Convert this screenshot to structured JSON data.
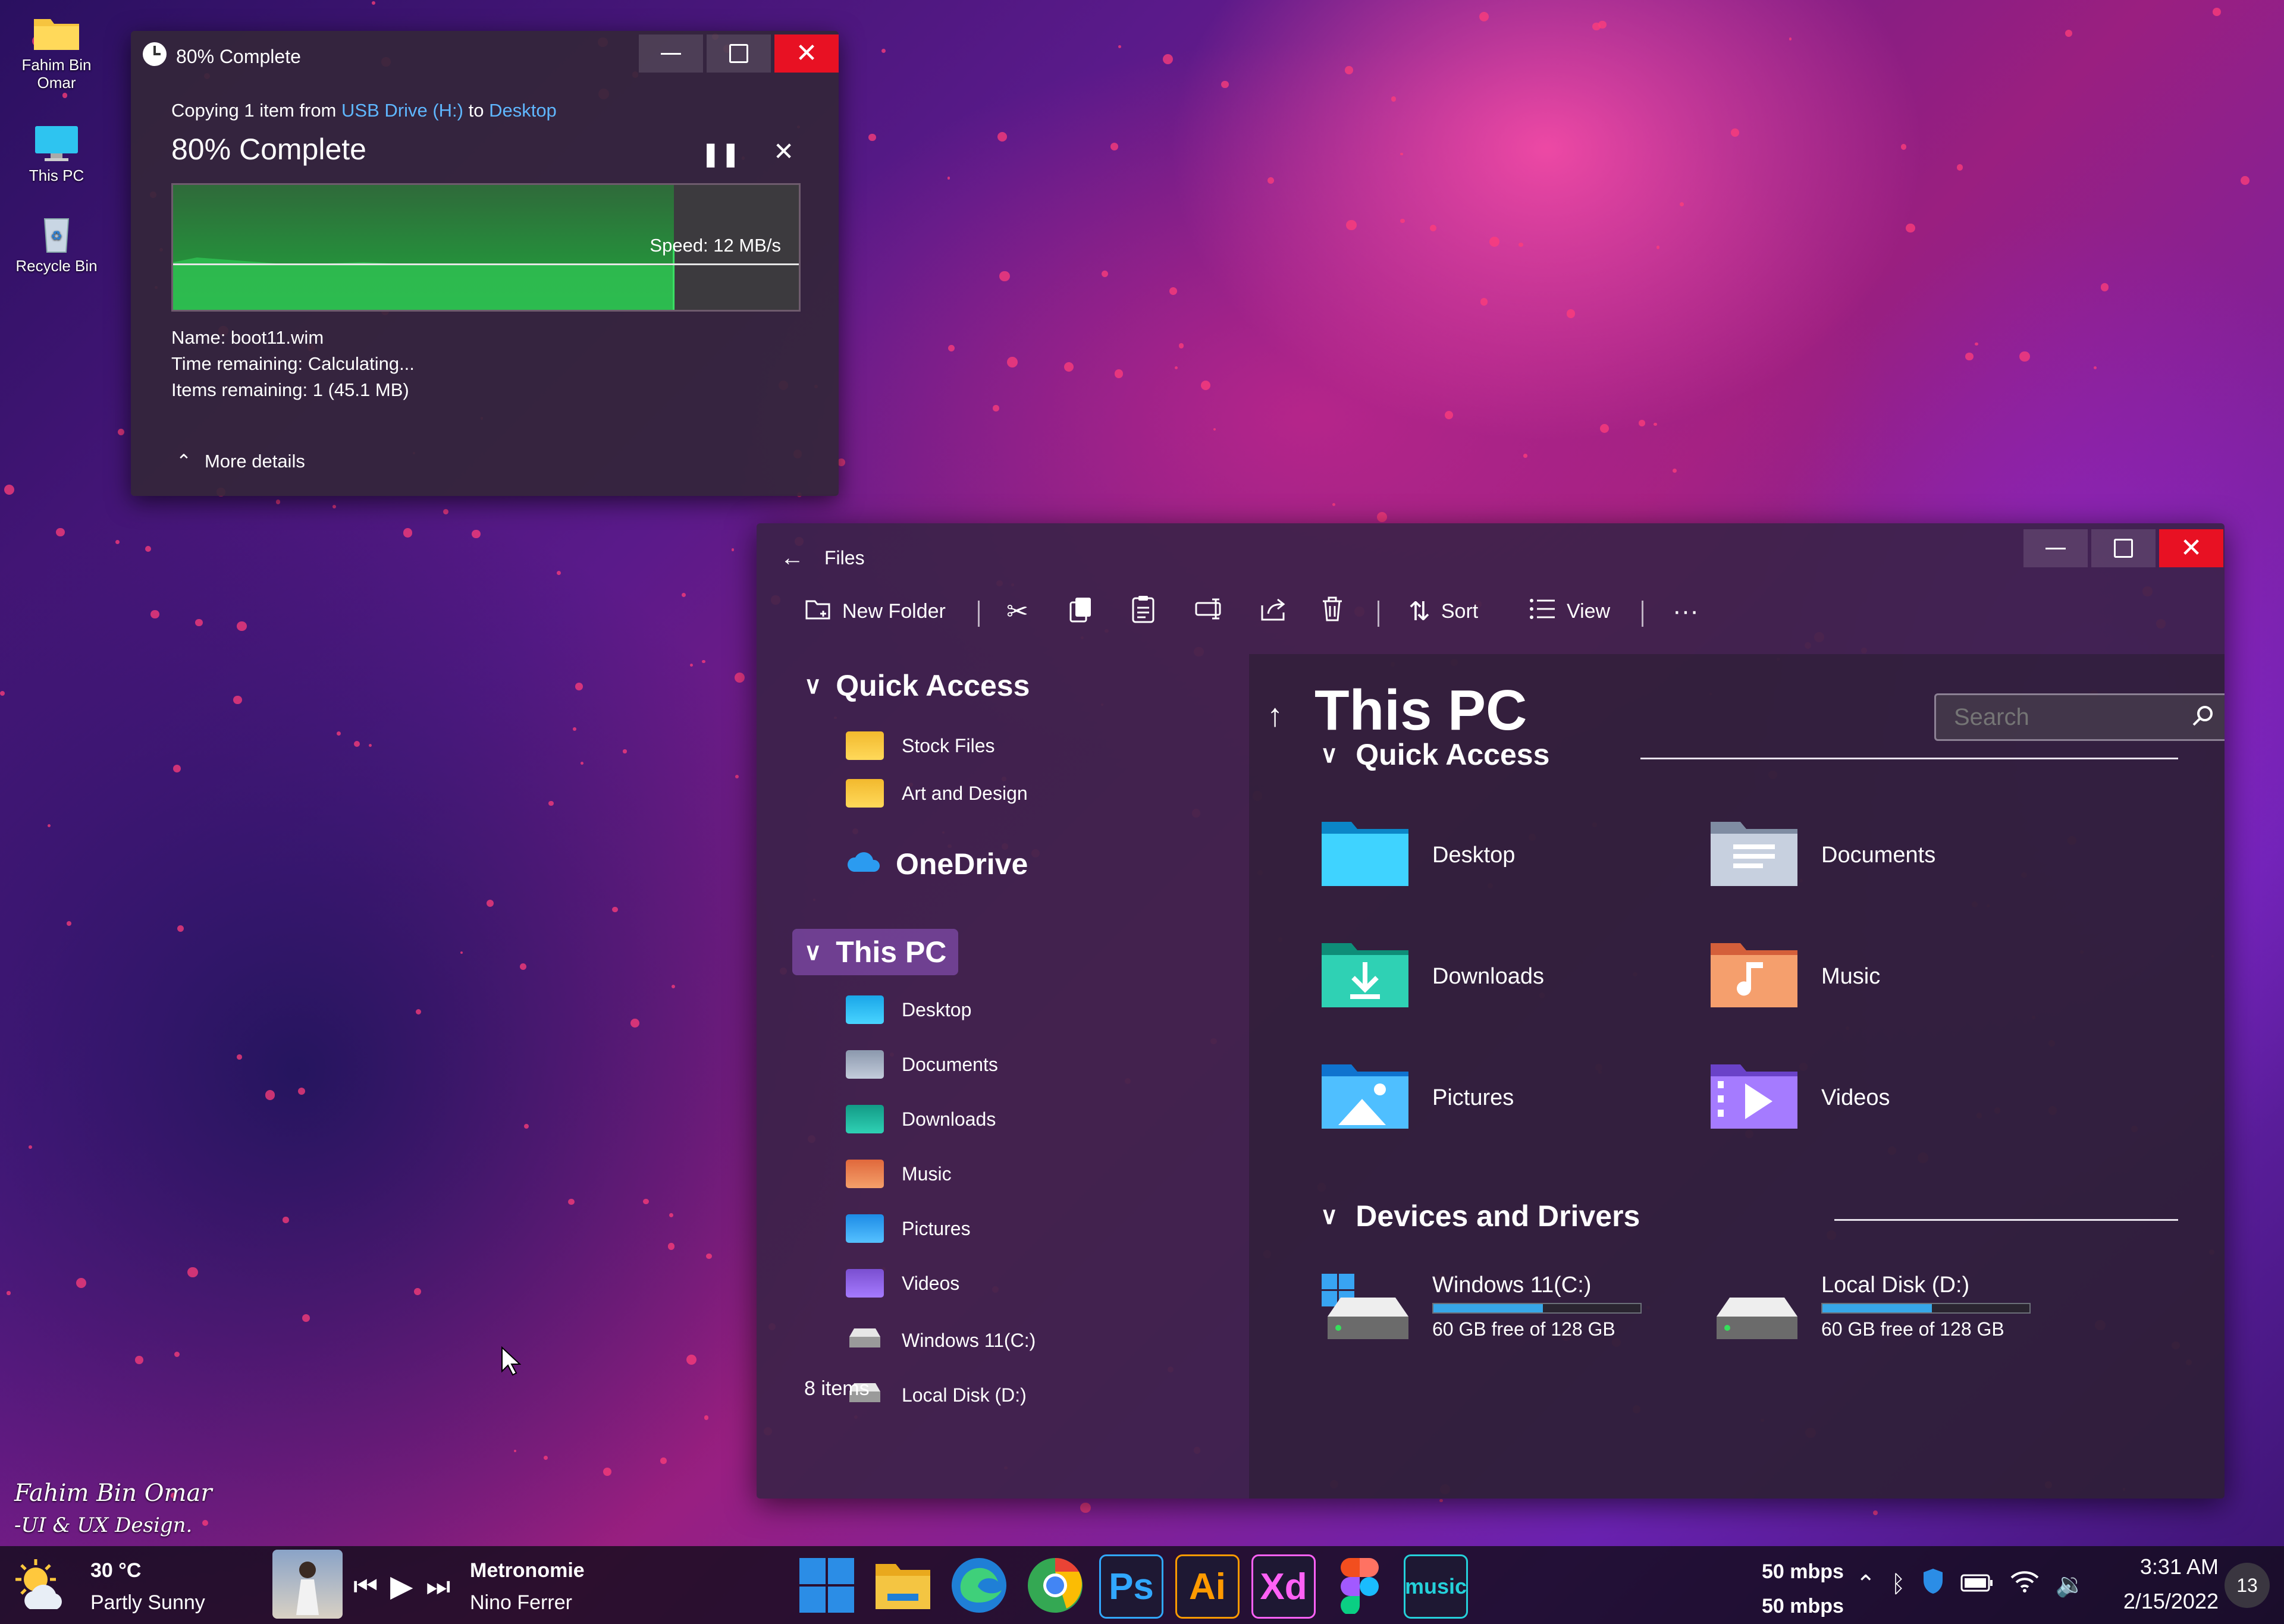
{
  "desktop": {
    "icons": [
      {
        "label": "Fahim Bin Omar",
        "icon": "folder-icon"
      },
      {
        "label": "This PC",
        "icon": "monitor-icon"
      },
      {
        "label": "Recycle Bin",
        "icon": "recycle-bin-icon"
      }
    ],
    "signature": {
      "line1": "Fahim Bin Omar",
      "line2": "-UI & UX Design."
    }
  },
  "copy_dialog": {
    "title": "80% Complete",
    "progress": 0.8,
    "copy_prefix": "Copying 1 item from",
    "source": "USB Drive (H:)",
    "copy_to": "to",
    "destination": "Desktop",
    "status": "80% Complete",
    "speed": "Speed: 12 MB/s",
    "name": "Name: boot11.wim",
    "time_remaining": "Time remaining: Calculating...",
    "items_remaining": "Items remaining: 1 (45.1 MB)",
    "more_details": "More details",
    "accent_color": "#1fa63c"
  },
  "explorer": {
    "title": "Files",
    "toolbar": {
      "new_folder": "New Folder",
      "sort": "Sort",
      "view": "View"
    },
    "sidebar": {
      "quick_access": "Quick Access",
      "quick_items": [
        "Stock Files",
        "Art and Design"
      ],
      "onedrive": "OneDrive",
      "this_pc": "This PC",
      "pc_items": [
        "Desktop",
        "Documents",
        "Downloads",
        "Music",
        "Pictures",
        "Videos",
        "Windows 11(C:)",
        "Local Disk (D:)"
      ],
      "status": "8 items"
    },
    "main": {
      "heading": "This PC",
      "search_placeholder": "Search",
      "quick_access": "Quick Access",
      "folders": [
        "Desktop",
        "Documents",
        "Downloads",
        "Music",
        "Pictures",
        "Videos"
      ],
      "devices_heading": "Devices and Drivers",
      "drives": [
        {
          "name": "Windows 11(C:)",
          "free": "60 GB free of 128 GB",
          "used_fraction": 0.53
        },
        {
          "name": "Local Disk (D:)",
          "free": "60 GB free of 128 GB",
          "used_fraction": 0.53
        }
      ]
    }
  },
  "taskbar": {
    "weather": {
      "temp": "30 °C",
      "condition": "Partly Sunny"
    },
    "media": {
      "track": "Metronomie",
      "artist": "Nino Ferrer"
    },
    "apps": [
      {
        "label": "",
        "icon": "windows-start-icon",
        "color": "#2b8de6"
      },
      {
        "label": "",
        "icon": "file-explorer-icon",
        "color": "#f4c542"
      },
      {
        "label": "",
        "icon": "edge-icon",
        "color": "#1f7fd6"
      },
      {
        "label": "",
        "icon": "chrome-icon",
        "color": "#e8453c"
      },
      {
        "label": "Ps",
        "icon": "photoshop-icon",
        "color": "#31a8ff"
      },
      {
        "label": "Ai",
        "icon": "illustrator-icon",
        "color": "#ff9a00"
      },
      {
        "label": "Xd",
        "icon": "xd-icon",
        "color": "#ff61f6"
      },
      {
        "label": "",
        "icon": "figma-icon",
        "color": "#a259ff"
      },
      {
        "label": "music",
        "icon": "amazon-music-icon",
        "color": "#25d1da"
      }
    ],
    "net_up": "50 mbps",
    "net_down": "50 mbps",
    "time": "3:31 AM",
    "date": "2/15/2022",
    "notifications": "13"
  }
}
